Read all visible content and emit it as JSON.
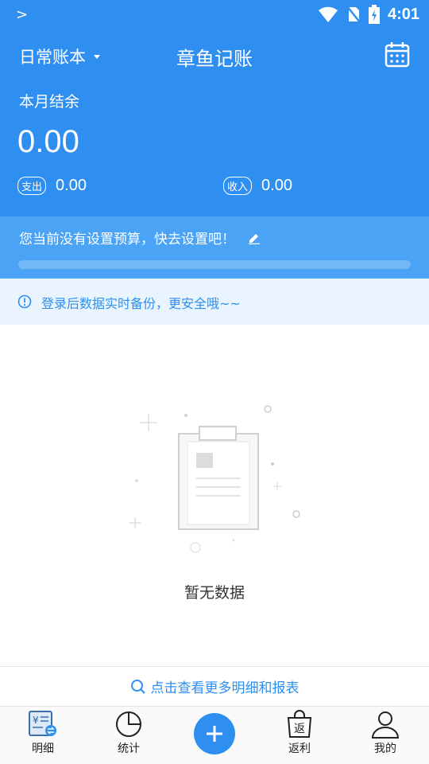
{
  "status_bar": {
    "time": "4:01"
  },
  "header": {
    "book_name": "日常账本",
    "app_title": "章鱼记账",
    "month_label": "本月结余",
    "balance": "0.00",
    "expense_tag": "支出",
    "expense_value": "0.00",
    "income_tag": "收入",
    "income_value": "0.00"
  },
  "budget": {
    "message": "您当前没有设置预算，快去设置吧！",
    "progress_fraction": 0
  },
  "notice": {
    "message": "登录后数据实时备份，更安全哦~~"
  },
  "empty_state": {
    "message": "暂无数据"
  },
  "more_link": {
    "label": "点击查看更多明细和报表"
  },
  "tabbar": {
    "tabs": [
      {
        "label": "明细",
        "icon": "ledger-icon"
      },
      {
        "label": "统计",
        "icon": "pie-chart-icon"
      },
      {
        "label": "返利",
        "icon": "shopping-bag-icon",
        "glyph": "返"
      },
      {
        "label": "我的",
        "icon": "user-icon"
      }
    ]
  },
  "colors": {
    "primary": "#2e8ff0",
    "budget_bg": "#4aa3f5",
    "notice_bg": "#e9f4fe"
  }
}
